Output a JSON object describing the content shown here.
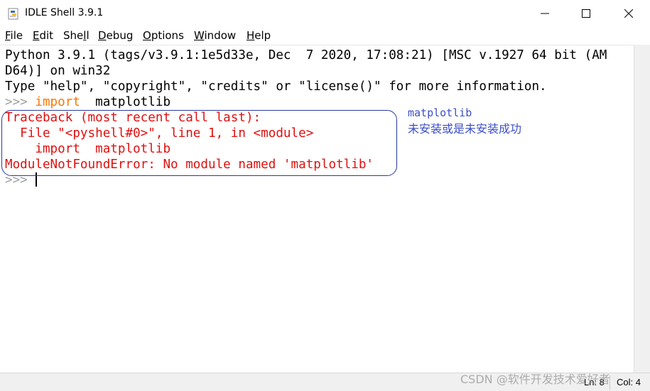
{
  "window": {
    "title": "IDLE Shell 3.9.1",
    "icon": "python-icon",
    "controls": [
      "minimize-icon",
      "maximize-icon",
      "close-icon"
    ]
  },
  "menu": {
    "file": {
      "accel": "F",
      "rest": "ile"
    },
    "edit": {
      "accel": "E",
      "rest": "dit"
    },
    "shell": {
      "pre": "She",
      "accel": "l",
      "rest": "l"
    },
    "debug": {
      "accel": "D",
      "rest": "ebug"
    },
    "options": {
      "accel": "O",
      "rest": "ptions"
    },
    "window": {
      "accel": "W",
      "rest": "indow"
    },
    "help": {
      "accel": "H",
      "rest": "elp"
    }
  },
  "shell": {
    "banner_line1": "Python 3.9.1 (tags/v3.9.1:1e5d33e, Dec  7 2020, 17:08:21) [MSC v.1927 64 bit (AM",
    "banner_line2": "D64)] on win32",
    "banner_line3": "Type \"help\", \"copyright\", \"credits\" or \"license()\" for more information.",
    "prompt": ">>> ",
    "cmd_keyword": "import",
    "cmd_rest": "  matplotlib",
    "tb_line1": "Traceback (most recent call last):",
    "tb_line2": "  File \"<pyshell#0>\", line 1, in <module>",
    "tb_line3": "    import  matplotlib",
    "tb_line4": "ModuleNotFoundError: No module named 'matplotlib'",
    "prompt2": ">>> "
  },
  "annotation": {
    "line1": "matplotlib",
    "line2": "未安装或是未安装成功",
    "color": "#3b4fc8"
  },
  "status": {
    "ln": "Ln: 8",
    "col": "Col: 4"
  },
  "watermark": "CSDN @软件开发技术爱好者"
}
